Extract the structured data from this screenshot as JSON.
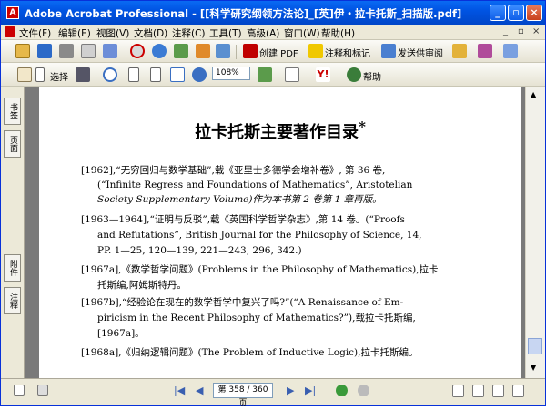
{
  "window": {
    "title": "Adobe Acrobat Professional - [[科学研究纲领方法论]_[英]伊・拉卡托斯_扫描版.pdf]",
    "app_icon": "acrobat-icon"
  },
  "menu": {
    "items": [
      "文件(F)",
      "编辑(E)",
      "视图(V)",
      "文档(D)",
      "注释(C)",
      "工具(T)",
      "高级(A)",
      "窗口(W)",
      "帮助(H)"
    ],
    "mdi_controls": [
      "_",
      "▫",
      "×"
    ]
  },
  "toolbar1": {
    "create_pdf": "创建 PDF",
    "comment": "注释和标记",
    "send_review": "发送供审阅"
  },
  "toolbar2": {
    "select": "选择",
    "zoom": "108%",
    "help": "帮助"
  },
  "sidebar": {
    "tabs": [
      "书签",
      "页面",
      "附件",
      "注释"
    ]
  },
  "document": {
    "title": "拉卡托斯主要著作目录",
    "title_mark": "*",
    "lines": [
      "[1962],“无穷回归与数学基础”,载《亚里士多德学会增补卷》, 第 36 卷,",
      "(“Infinite Regress and Foundations of Mathematics”, Aristotelian",
      "Society Supplementary Volume)作为本书第 2 卷第 1 章再版。",
      "[1963—1964],“证明与反驳”,载《英国科学哲学杂志》,第 14 卷。(“Proofs",
      "and Refutations”, British Journal for the Philosophy of Science, 14,",
      "PP. 1—25, 120—139, 221—243, 296, 342.)",
      "[1967a],《数学哲学问题》(Problems in the Philosophy of Mathematics),拉卡",
      "托斯编,阿姆斯特丹。",
      "[1967b],“经验论在现在的数学哲学中复兴了吗?”(“A Renaissance of Em-",
      "piricism in the Recent Philosophy of Mathematics?”),载拉卡托斯编,",
      "[1967a]。",
      "[1968a],《归纳逻辑问题》(The Problem of Inductive Logic),拉卡托斯编。"
    ]
  },
  "status": {
    "page_indicator": "第 358 / 360 页"
  },
  "colors": {
    "titlebar": "#0054e3",
    "doc_bg": "#7a7a7a",
    "accent": "#c00000"
  }
}
